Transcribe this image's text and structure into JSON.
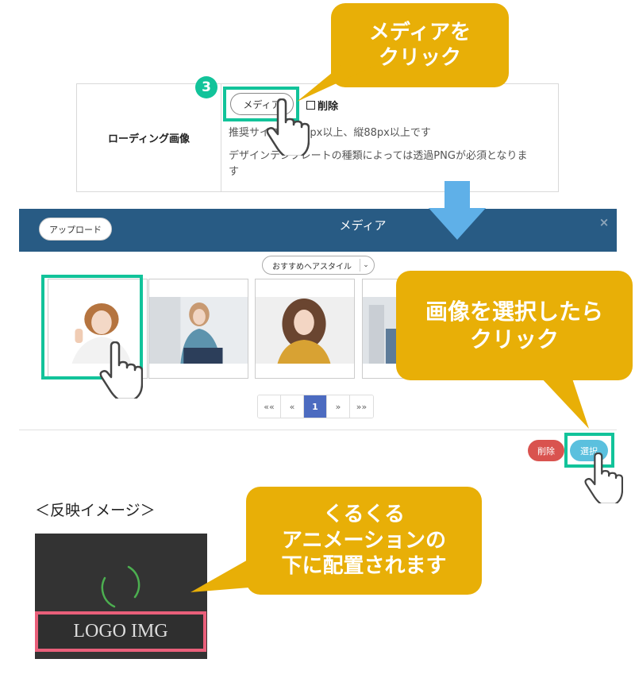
{
  "settings": {
    "row_label": "ローディング画像",
    "media_button": "メディア",
    "delete_label": "削除",
    "note_recommended": "推奨サイズ：400px以上、縦88px以上です",
    "note_png_line1": "デザインテンプレートの種類によっては透過PNGが必須となりま",
    "note_png_line2": "す"
  },
  "step_badge": "3",
  "callouts": {
    "media_click": {
      "line1": "メディアを",
      "line2": "クリック"
    },
    "select_click": {
      "line1": "画像を選択したら",
      "line2": "クリック"
    },
    "spinner_note": {
      "line1": "くるくる",
      "line2": "アニメーションの",
      "line3": "下に配置されます"
    }
  },
  "modal": {
    "upload_button": "アップロード",
    "title": "メディア",
    "close": "×",
    "style_select": "おすすめヘアスタイル",
    "pagination": [
      "««",
      "«",
      "1",
      "»",
      "»»"
    ],
    "current_page": "1",
    "delete_button": "削除",
    "select_button": "選択"
  },
  "preview": {
    "label": "＜反映イメージ＞",
    "logo_text": "LOGO IMG"
  },
  "colors": {
    "callout": "#e8af07",
    "highlight_green": "#12c39a",
    "highlight_pink": "#e95f7a",
    "modal_header": "#285b84",
    "page_active": "#4c6bc0",
    "delete_red": "#d9534f",
    "select_blue": "#5bc0de"
  }
}
